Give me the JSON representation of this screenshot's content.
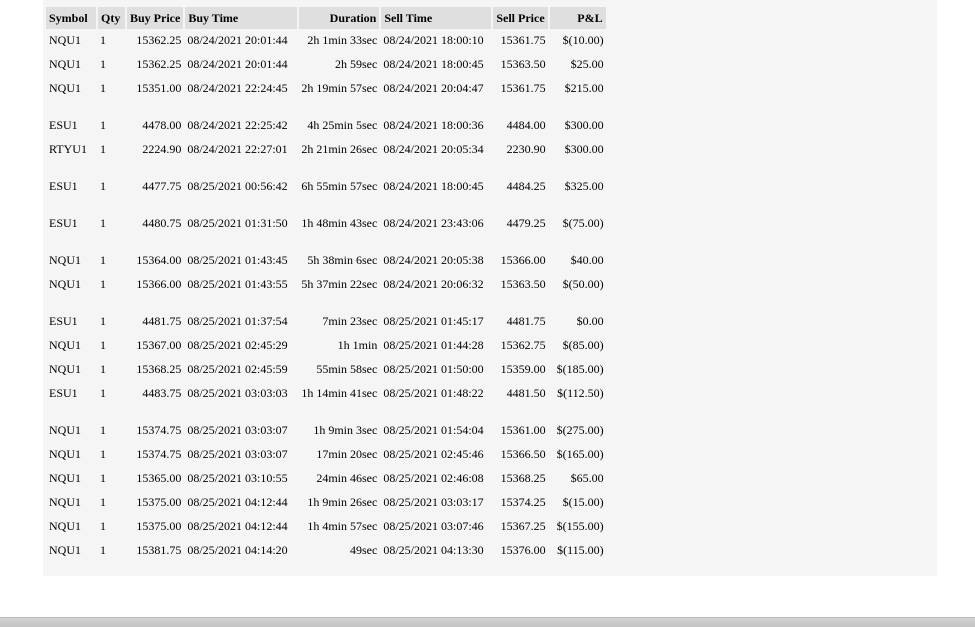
{
  "columns": [
    "Symbol",
    "Qty",
    "Buy Price",
    "Buy Time",
    "Duration",
    "Sell Time",
    "Sell Price",
    "P&L"
  ],
  "rows": [
    {
      "symbol": "NQU1",
      "qty": "1",
      "buy_price": "15362.25",
      "buy_time": "08/24/2021 20:01:44",
      "duration": "2h 1min 33sec",
      "sell_time": "08/24/2021 18:00:10",
      "sell_price": "15361.75",
      "pnl": "$(10.00)"
    },
    {
      "symbol": "NQU1",
      "qty": "1",
      "buy_price": "15362.25",
      "buy_time": "08/24/2021 20:01:44",
      "duration": "2h 59sec",
      "sell_time": "08/24/2021 18:00:45",
      "sell_price": "15363.50",
      "pnl": "$25.00"
    },
    {
      "symbol": "NQU1",
      "qty": "1",
      "buy_price": "15351.00",
      "buy_time": "08/24/2021 22:24:45",
      "duration": "2h 19min 57sec",
      "sell_time": "08/24/2021 20:04:47",
      "sell_price": "15361.75",
      "pnl": "$215.00"
    },
    {
      "symbol": "ESU1",
      "qty": "1",
      "buy_price": "4478.00",
      "buy_time": "08/24/2021 22:25:42",
      "duration": "4h 25min 5sec",
      "sell_time": "08/24/2021 18:00:36",
      "sell_price": "4484.00",
      "pnl": "$300.00"
    },
    {
      "symbol": "RTYU1",
      "qty": "1",
      "buy_price": "2224.90",
      "buy_time": "08/24/2021 22:27:01",
      "duration": "2h 21min 26sec",
      "sell_time": "08/24/2021 20:05:34",
      "sell_price": "2230.90",
      "pnl": "$300.00"
    },
    {
      "symbol": "ESU1",
      "qty": "1",
      "buy_price": "4477.75",
      "buy_time": "08/25/2021 00:56:42",
      "duration": "6h 55min 57sec",
      "sell_time": "08/24/2021 18:00:45",
      "sell_price": "4484.25",
      "pnl": "$325.00"
    },
    {
      "symbol": "ESU1",
      "qty": "1",
      "buy_price": "4480.75",
      "buy_time": "08/25/2021 01:31:50",
      "duration": "1h 48min 43sec",
      "sell_time": "08/24/2021 23:43:06",
      "sell_price": "4479.25",
      "pnl": "$(75.00)"
    },
    {
      "symbol": "NQU1",
      "qty": "1",
      "buy_price": "15364.00",
      "buy_time": "08/25/2021 01:43:45",
      "duration": "5h 38min 6sec",
      "sell_time": "08/24/2021 20:05:38",
      "sell_price": "15366.00",
      "pnl": "$40.00"
    },
    {
      "symbol": "NQU1",
      "qty": "1",
      "buy_price": "15366.00",
      "buy_time": "08/25/2021 01:43:55",
      "duration": "5h 37min 22sec",
      "sell_time": "08/24/2021 20:06:32",
      "sell_price": "15363.50",
      "pnl": "$(50.00)"
    },
    {
      "symbol": "ESU1",
      "qty": "1",
      "buy_price": "4481.75",
      "buy_time": "08/25/2021 01:37:54",
      "duration": "7min 23sec",
      "sell_time": "08/25/2021 01:45:17",
      "sell_price": "4481.75",
      "pnl": "$0.00"
    },
    {
      "symbol": "NQU1",
      "qty": "1",
      "buy_price": "15367.00",
      "buy_time": "08/25/2021 02:45:29",
      "duration": "1h 1min",
      "sell_time": "08/25/2021 01:44:28",
      "sell_price": "15362.75",
      "pnl": "$(85.00)"
    },
    {
      "symbol": "NQU1",
      "qty": "1",
      "buy_price": "15368.25",
      "buy_time": "08/25/2021 02:45:59",
      "duration": "55min 58sec",
      "sell_time": "08/25/2021 01:50:00",
      "sell_price": "15359.00",
      "pnl": "$(185.00)"
    },
    {
      "symbol": "ESU1",
      "qty": "1",
      "buy_price": "4483.75",
      "buy_time": "08/25/2021 03:03:03",
      "duration": "1h 14min 41sec",
      "sell_time": "08/25/2021 01:48:22",
      "sell_price": "4481.50",
      "pnl": "$(112.50)"
    },
    {
      "symbol": "NQU1",
      "qty": "1",
      "buy_price": "15374.75",
      "buy_time": "08/25/2021 03:03:07",
      "duration": "1h 9min 3sec",
      "sell_time": "08/25/2021 01:54:04",
      "sell_price": "15361.00",
      "pnl": "$(275.00)"
    },
    {
      "symbol": "NQU1",
      "qty": "1",
      "buy_price": "15374.75",
      "buy_time": "08/25/2021 03:03:07",
      "duration": "17min 20sec",
      "sell_time": "08/25/2021 02:45:46",
      "sell_price": "15366.50",
      "pnl": "$(165.00)"
    },
    {
      "symbol": "NQU1",
      "qty": "1",
      "buy_price": "15365.00",
      "buy_time": "08/25/2021 03:10:55",
      "duration": "24min 46sec",
      "sell_time": "08/25/2021 02:46:08",
      "sell_price": "15368.25",
      "pnl": "$65.00"
    },
    {
      "symbol": "NQU1",
      "qty": "1",
      "buy_price": "15375.00",
      "buy_time": "08/25/2021 04:12:44",
      "duration": "1h 9min 26sec",
      "sell_time": "08/25/2021 03:03:17",
      "sell_price": "15374.25",
      "pnl": "$(15.00)"
    },
    {
      "symbol": "NQU1",
      "qty": "1",
      "buy_price": "15375.00",
      "buy_time": "08/25/2021 04:12:44",
      "duration": "1h 4min 57sec",
      "sell_time": "08/25/2021 03:07:46",
      "sell_price": "15367.25",
      "pnl": "$(155.00)"
    },
    {
      "symbol": "NQU1",
      "qty": "1",
      "buy_price": "15381.75",
      "buy_time": "08/25/2021 04:14:20",
      "duration": "49sec",
      "sell_time": "08/25/2021 04:13:30",
      "sell_price": "15376.00",
      "pnl": "$(115.00)"
    }
  ]
}
